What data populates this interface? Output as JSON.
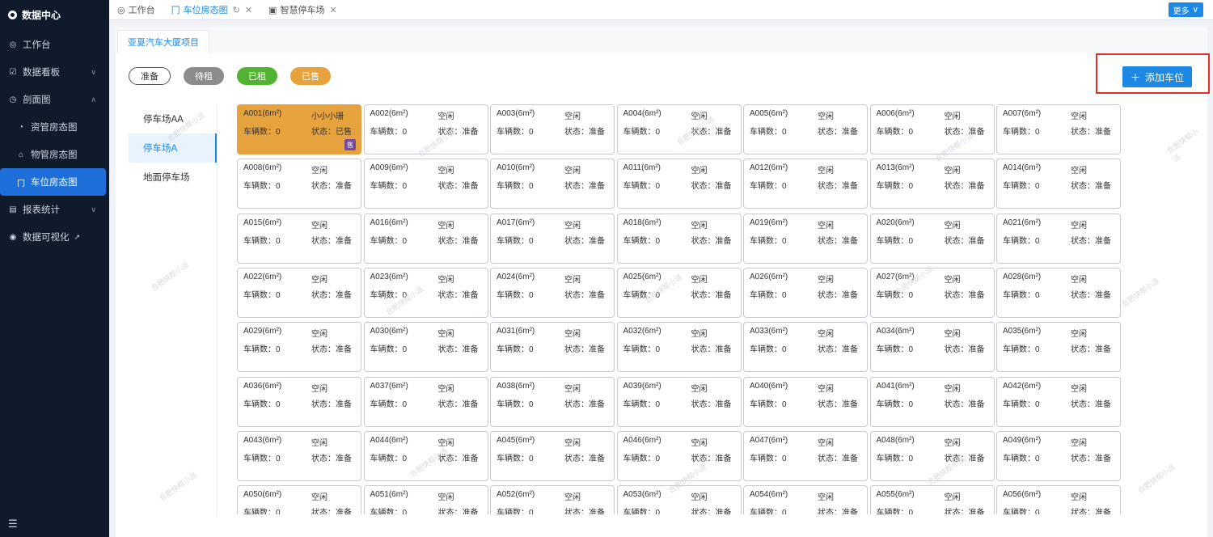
{
  "sidebar": {
    "brand": "数据中心",
    "items": [
      {
        "label": "工作台",
        "icon": "dashboard-icon"
      },
      {
        "label": "数据看板",
        "icon": "board-icon"
      },
      {
        "label": "剖面图",
        "icon": "section-icon"
      },
      {
        "label": "资管房态图",
        "icon": "chart-icon"
      },
      {
        "label": "物管房态图",
        "icon": "home-icon"
      },
      {
        "label": "车位房态图",
        "icon": "parking-icon"
      },
      {
        "label": "报表统计",
        "icon": "report-icon"
      },
      {
        "label": "数据可视化",
        "icon": "visual-icon"
      }
    ]
  },
  "tabs": [
    {
      "label": "工作台"
    },
    {
      "label": "车位房态图"
    },
    {
      "label": "智慧停车场"
    }
  ],
  "more_label": "更多",
  "project_tab": "亚夏汽车大厦项目",
  "legend": {
    "ready": "准备",
    "pending": "待租",
    "rented": "已租",
    "sold": "已售"
  },
  "add_button": "添加车位",
  "lots": [
    "停车场AA",
    "停车场A",
    "地面停车场"
  ],
  "space_labels": {
    "count_prefix": "车辆数：",
    "state_prefix": "状态："
  },
  "spaces": [
    {
      "code": "A001(6m²)",
      "status": "小小小珊",
      "count": "0",
      "state": "已售",
      "tag": "售"
    },
    {
      "code": "A002(6m²)",
      "status": "空闲",
      "count": "0",
      "state": "准备"
    },
    {
      "code": "A003(6m²)",
      "status": "空闲",
      "count": "0",
      "state": "准备"
    },
    {
      "code": "A004(6m²)",
      "status": "空闲",
      "count": "0",
      "state": "准备"
    },
    {
      "code": "A005(6m²)",
      "status": "空闲",
      "count": "0",
      "state": "准备"
    },
    {
      "code": "A006(6m²)",
      "status": "空闲",
      "count": "0",
      "state": "准备"
    },
    {
      "code": "A007(6m²)",
      "status": "空闲",
      "count": "0",
      "state": "准备"
    },
    {
      "code": "A008(6m²)",
      "status": "空闲",
      "count": "0",
      "state": "准备"
    },
    {
      "code": "A009(6m²)",
      "status": "空闲",
      "count": "0",
      "state": "准备"
    },
    {
      "code": "A010(6m²)",
      "status": "空闲",
      "count": "0",
      "state": "准备"
    },
    {
      "code": "A011(6m²)",
      "status": "空闲",
      "count": "0",
      "state": "准备"
    },
    {
      "code": "A012(6m²)",
      "status": "空闲",
      "count": "0",
      "state": "准备"
    },
    {
      "code": "A013(6m²)",
      "status": "空闲",
      "count": "0",
      "state": "准备"
    },
    {
      "code": "A014(6m²)",
      "status": "空闲",
      "count": "0",
      "state": "准备"
    },
    {
      "code": "A015(6m²)",
      "status": "空闲",
      "count": "0",
      "state": "准备"
    },
    {
      "code": "A016(6m²)",
      "status": "空闲",
      "count": "0",
      "state": "准备"
    },
    {
      "code": "A017(6m²)",
      "status": "空闲",
      "count": "0",
      "state": "准备"
    },
    {
      "code": "A018(6m²)",
      "status": "空闲",
      "count": "0",
      "state": "准备"
    },
    {
      "code": "A019(6m²)",
      "status": "空闲",
      "count": "0",
      "state": "准备"
    },
    {
      "code": "A020(6m²)",
      "status": "空闲",
      "count": "0",
      "state": "准备"
    },
    {
      "code": "A021(6m²)",
      "status": "空闲",
      "count": "0",
      "state": "准备"
    },
    {
      "code": "A022(6m²)",
      "status": "空闲",
      "count": "0",
      "state": "准备"
    },
    {
      "code": "A023(6m²)",
      "status": "空闲",
      "count": "0",
      "state": "准备"
    },
    {
      "code": "A024(6m²)",
      "status": "空闲",
      "count": "0",
      "state": "准备"
    },
    {
      "code": "A025(6m²)",
      "status": "空闲",
      "count": "0",
      "state": "准备"
    },
    {
      "code": "A026(6m²)",
      "status": "空闲",
      "count": "0",
      "state": "准备"
    },
    {
      "code": "A027(6m²)",
      "status": "空闲",
      "count": "0",
      "state": "准备"
    },
    {
      "code": "A028(6m²)",
      "status": "空闲",
      "count": "0",
      "state": "准备"
    },
    {
      "code": "A029(6m²)",
      "status": "空闲",
      "count": "0",
      "state": "准备"
    },
    {
      "code": "A030(6m²)",
      "status": "空闲",
      "count": "0",
      "state": "准备"
    },
    {
      "code": "A031(6m²)",
      "status": "空闲",
      "count": "0",
      "state": "准备"
    },
    {
      "code": "A032(6m²)",
      "status": "空闲",
      "count": "0",
      "state": "准备"
    },
    {
      "code": "A033(6m²)",
      "status": "空闲",
      "count": "0",
      "state": "准备"
    },
    {
      "code": "A034(6m²)",
      "status": "空闲",
      "count": "0",
      "state": "准备"
    },
    {
      "code": "A035(6m²)",
      "status": "空闲",
      "count": "0",
      "state": "准备"
    },
    {
      "code": "A036(6m²)",
      "status": "空闲",
      "count": "0",
      "state": "准备"
    },
    {
      "code": "A037(6m²)",
      "status": "空闲",
      "count": "0",
      "state": "准备"
    },
    {
      "code": "A038(6m²)",
      "status": "空闲",
      "count": "0",
      "state": "准备"
    },
    {
      "code": "A039(6m²)",
      "status": "空闲",
      "count": "0",
      "state": "准备"
    },
    {
      "code": "A040(6m²)",
      "status": "空闲",
      "count": "0",
      "state": "准备"
    },
    {
      "code": "A041(6m²)",
      "status": "空闲",
      "count": "0",
      "state": "准备"
    },
    {
      "code": "A042(6m²)",
      "status": "空闲",
      "count": "0",
      "state": "准备"
    },
    {
      "code": "A043(6m²)",
      "status": "空闲",
      "count": "0",
      "state": "准备"
    },
    {
      "code": "A044(6m²)",
      "status": "空闲",
      "count": "0",
      "state": "准备"
    },
    {
      "code": "A045(6m²)",
      "status": "空闲",
      "count": "0",
      "state": "准备"
    },
    {
      "code": "A046(6m²)",
      "status": "空闲",
      "count": "0",
      "state": "准备"
    },
    {
      "code": "A047(6m²)",
      "status": "空闲",
      "count": "0",
      "state": "准备"
    },
    {
      "code": "A048(6m²)",
      "status": "空闲",
      "count": "0",
      "state": "准备"
    },
    {
      "code": "A049(6m²)",
      "status": "空闲",
      "count": "0",
      "state": "准备"
    },
    {
      "code": "A050(6m²)",
      "status": "空闲",
      "count": "0",
      "state": "准备"
    },
    {
      "code": "A051(6m²)",
      "status": "空闲",
      "count": "0",
      "state": "准备"
    },
    {
      "code": "A052(6m²)",
      "status": "空闲",
      "count": "0",
      "state": "准备"
    },
    {
      "code": "A053(6m²)",
      "status": "空闲",
      "count": "0",
      "state": "准备"
    },
    {
      "code": "A054(6m²)",
      "status": "空闲",
      "count": "0",
      "state": "准备"
    },
    {
      "code": "A055(6m²)",
      "status": "空闲",
      "count": "0",
      "state": "准备"
    },
    {
      "code": "A056(6m²)",
      "status": "空闲",
      "count": "0",
      "state": "准备"
    }
  ],
  "watermark": "合肥快帮小派"
}
